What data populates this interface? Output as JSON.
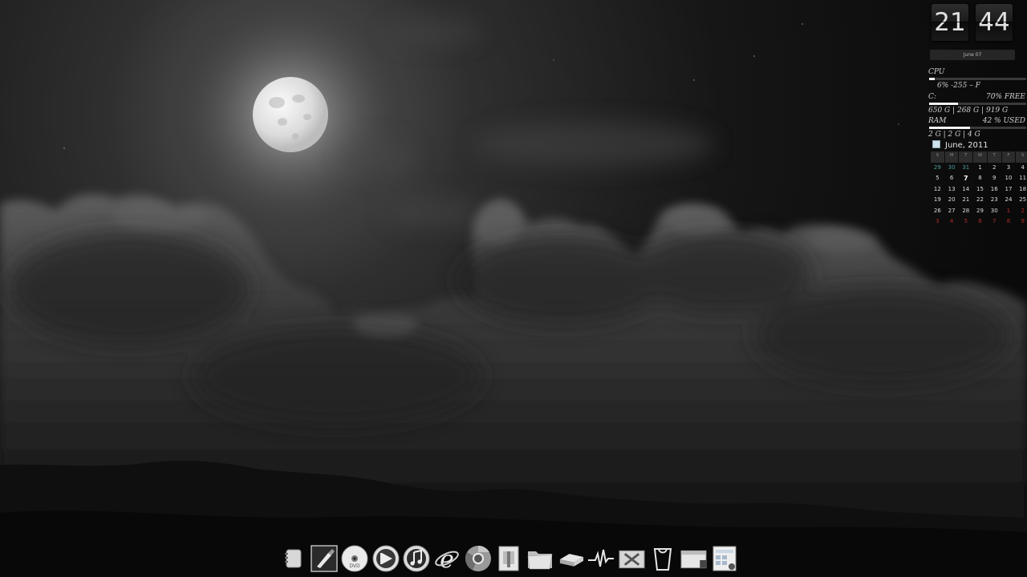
{
  "clock": {
    "hours": "21",
    "minutes": "44",
    "date": "June  07"
  },
  "sysmon": {
    "cpu_label": "CPU",
    "cpu_value": "6%  -255 – F",
    "cpu_fraction": 0.06,
    "disk_label": "C:",
    "disk_free": "70% FREE",
    "disk_detail": "650 G | 268 G | 919 G",
    "disk_used_fraction": 0.3,
    "ram_label": "RAM",
    "ram_used": "42 % USED",
    "ram_detail": "2 G | 2 G | 4 G",
    "ram_fraction": 0.42
  },
  "calendar": {
    "title": "June, 2011",
    "weekdays": [
      "S",
      "M",
      "T",
      "W",
      "T",
      "F",
      "S"
    ],
    "today": "7",
    "weeks": [
      [
        "29",
        "30",
        "31",
        "1",
        "2",
        "3",
        "4"
      ],
      [
        "5",
        "6",
        "7",
        "8",
        "9",
        "10",
        "11"
      ],
      [
        "12",
        "13",
        "14",
        "15",
        "16",
        "17",
        "18"
      ],
      [
        "19",
        "20",
        "21",
        "22",
        "23",
        "24",
        "25"
      ],
      [
        "26",
        "27",
        "28",
        "29",
        "30",
        "1",
        "2"
      ],
      [
        "3",
        "4",
        "5",
        "6",
        "7",
        "8",
        "9"
      ]
    ]
  },
  "dock": {
    "items": [
      {
        "name": "notes-icon"
      },
      {
        "name": "paint-brush-icon"
      },
      {
        "name": "dvd-icon"
      },
      {
        "name": "media-player-icon"
      },
      {
        "name": "music-icon"
      },
      {
        "name": "internet-explorer-icon"
      },
      {
        "name": "chrome-icon"
      },
      {
        "name": "document-icon"
      },
      {
        "name": "folder-icon"
      },
      {
        "name": "drive-icon"
      },
      {
        "name": "activity-monitor-icon"
      },
      {
        "name": "tools-icon"
      },
      {
        "name": "recycle-bin-icon"
      },
      {
        "name": "window-icon"
      },
      {
        "name": "control-panel-icon"
      }
    ]
  }
}
